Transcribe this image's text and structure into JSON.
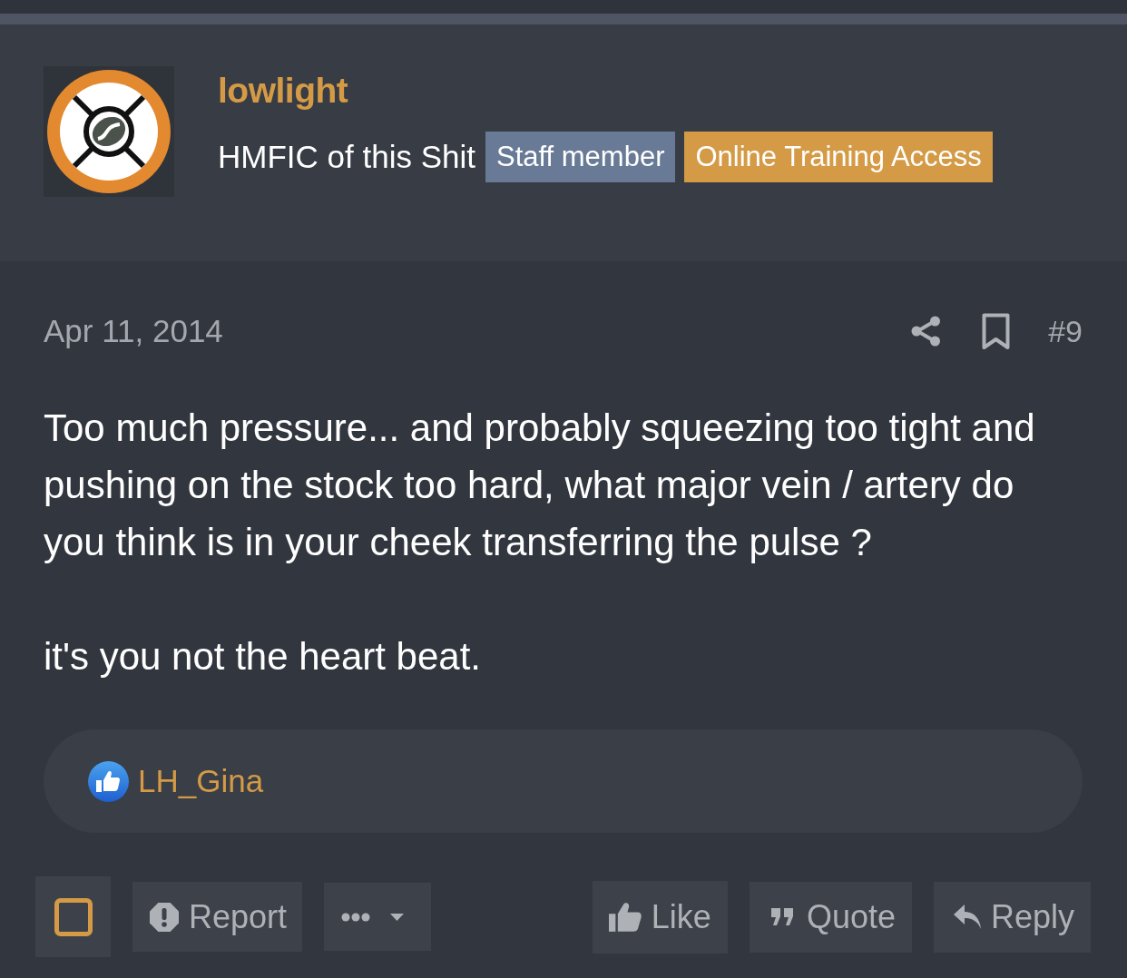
{
  "author": {
    "username": "lowlight",
    "user_title": "HMFIC of this Shit",
    "banners": [
      {
        "label": "Staff member",
        "color": "#687a96"
      },
      {
        "label": "Online Training Access",
        "color": "#d49a45"
      }
    ]
  },
  "post": {
    "date": "Apr 11, 2014",
    "post_number": "#9",
    "paragraphs": [
      "Too much pressure... and probably squeezing too tight and pushing on the stock too hard, what major vein / artery do you think is in your cheek transferring the pulse ?",
      "it's you not the heart beat."
    ]
  },
  "reactions": {
    "users": [
      "LH_Gina"
    ]
  },
  "actions_left": [
    {
      "kind": "select",
      "checked": false
    },
    {
      "kind": "report",
      "label": "Report"
    },
    {
      "kind": "more"
    }
  ],
  "actions_right": [
    {
      "kind": "like",
      "label": "Like"
    },
    {
      "kind": "quote",
      "label": "Quote"
    },
    {
      "kind": "reply",
      "label": "Reply"
    }
  ]
}
